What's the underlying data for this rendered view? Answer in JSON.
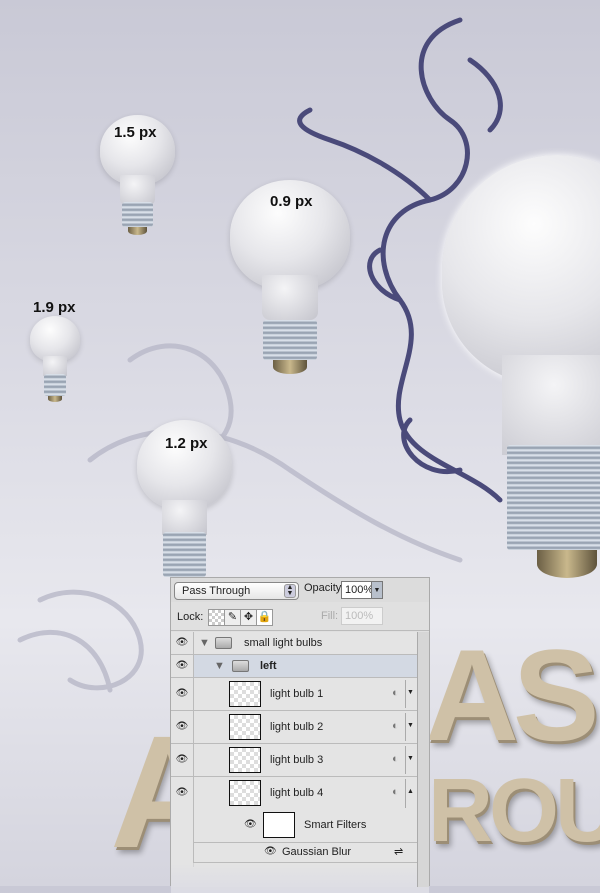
{
  "canvas": {
    "bulb_labels": [
      "1.5 px",
      "0.9 px",
      "1.9 px",
      "1.2 px"
    ],
    "letters_top": "AS",
    "letters_bottom": "ROU",
    "letters_left": "A"
  },
  "layers_panel": {
    "blend_mode": "Pass Through",
    "opacity_label": "Opacity:",
    "opacity_value": "100%",
    "lock_label": "Lock:",
    "fill_label": "Fill:",
    "fill_value": "100%",
    "layers": [
      {
        "name": "small light bulbs",
        "type": "group"
      },
      {
        "name": "left",
        "type": "group",
        "selected": true
      },
      {
        "name": "light bulb 1",
        "type": "smart-object"
      },
      {
        "name": "light bulb 2",
        "type": "smart-object"
      },
      {
        "name": "light bulb 3",
        "type": "smart-object"
      },
      {
        "name": "light bulb 4",
        "type": "smart-object"
      }
    ],
    "smart_filters_label": "Smart Filters",
    "filter_name": "Gaussian Blur",
    "colors": {
      "selected_row": "#d3d9e3",
      "panel": "#e0e0e0"
    }
  }
}
